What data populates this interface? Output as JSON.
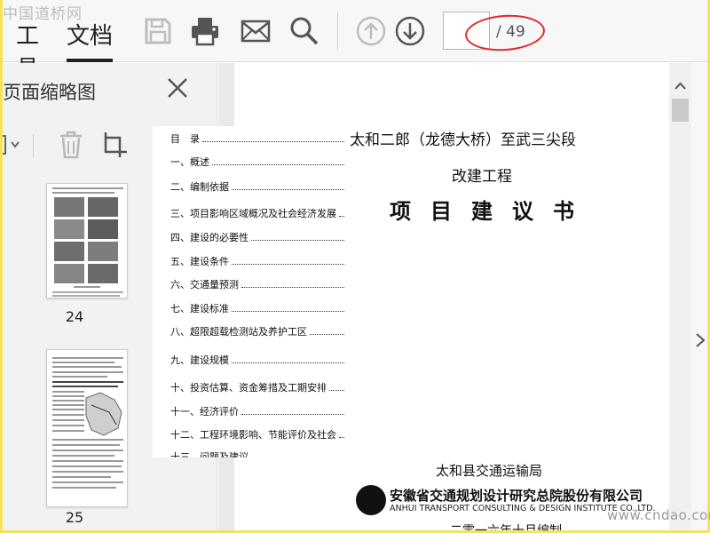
{
  "watermark_top": "中国道桥网",
  "watermark_bottom": "www.cndao.com",
  "toolbar": {
    "tab_tools": "工具",
    "tab_document": "文档",
    "page_total": "/ 49",
    "page_current": ""
  },
  "thumbnail_panel": {
    "title": "页面缩略图",
    "thumbnails": [
      {
        "page_label": "24"
      },
      {
        "page_label": "25"
      }
    ]
  },
  "document": {
    "title_line1": "太和二郎（龙德大桥）至武三尖段",
    "title_line2": "改建工程",
    "title_line3": "项目建议书",
    "issuer": "太和县交通运输局",
    "company_cn": "安徽省交通规划设计研究总院股份有限公司",
    "company_en": "ANHUI TRANSPORT CONSULTING & DESIGN INSTITUTE CO.,LTD.",
    "date_line": "二零一六年十月编制"
  },
  "toc": {
    "heading": "目　录",
    "items": [
      "一、概述",
      "二、编制依据",
      "三、项目影响区域概况及社会经济发展",
      "四、建设的必要性",
      "五、建设条件",
      "六、交通量预测",
      "七、建设标准",
      "八、超限超载检测站及养护工区",
      "九、建设规模",
      "十、投资估算、资金筹措及工期安排",
      "十一、经济评价",
      "十二、工程环境影响、节能评价及社会",
      "十三、问题及建议"
    ]
  },
  "colors": {
    "highlight_ellipse": "#e4262a",
    "frame": "#f4e45a",
    "toolbar_bg": "#f7f7f7",
    "panel_bg": "#f2f2f2"
  },
  "icons": [
    "save-icon",
    "print-icon",
    "email-icon",
    "search-icon",
    "page-up-icon",
    "page-down-icon",
    "close-icon",
    "options-dropdown-icon",
    "delete-icon",
    "crop-icon",
    "scroll-up-icon",
    "expand-right-icon"
  ]
}
